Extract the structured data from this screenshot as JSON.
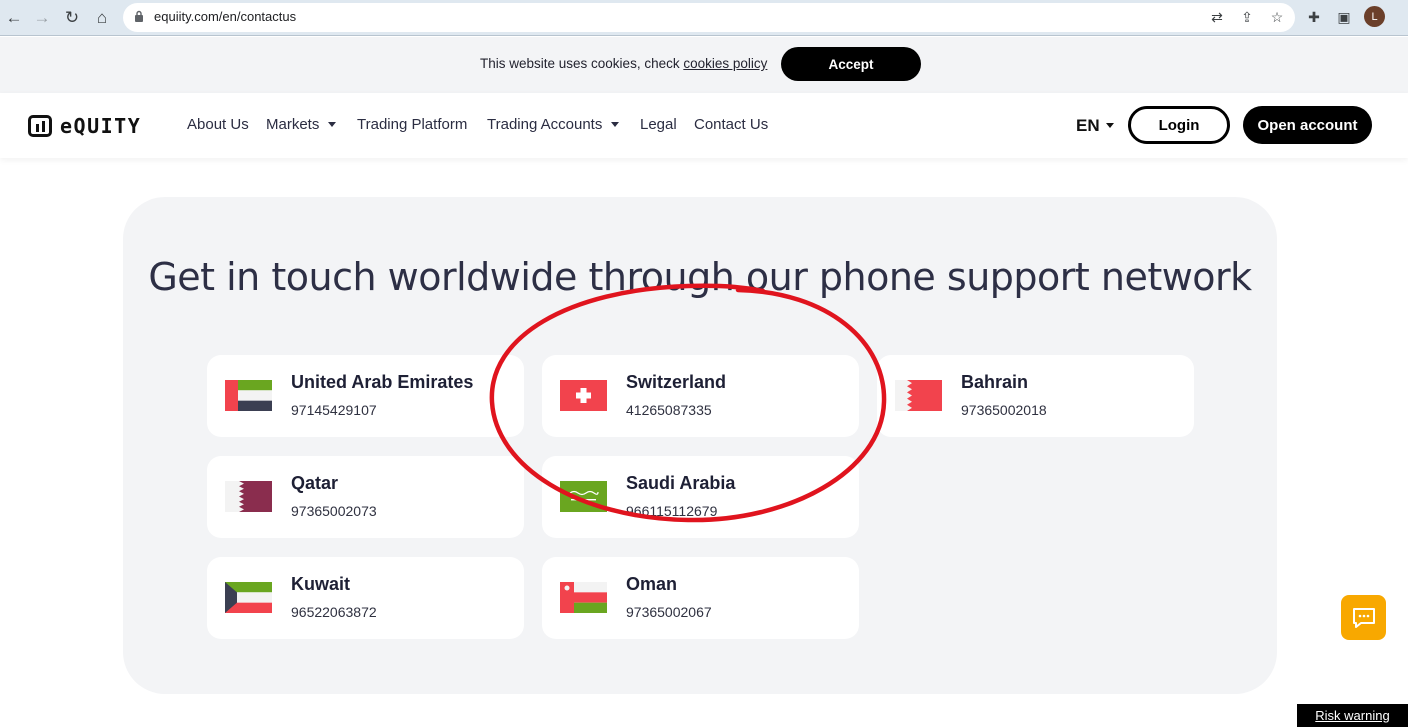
{
  "browser": {
    "url": "equiity.com/en/contactus",
    "profile_initial": "L"
  },
  "cookie": {
    "text": "This website uses cookies, check ",
    "link": "cookies policy",
    "accept": "Accept"
  },
  "header": {
    "logo_text": "eQUITY",
    "menu": [
      "About Us",
      "Markets",
      "Trading Platform",
      "Trading Accounts",
      "Legal",
      "Contact Us"
    ],
    "lang": "EN",
    "login": "Login",
    "open_account": "Open account"
  },
  "main": {
    "heading": "Get in touch worldwide through our phone support network",
    "contacts": [
      {
        "country": "United Arab Emirates",
        "phone": "97145429107"
      },
      {
        "country": "Switzerland",
        "phone": "41265087335"
      },
      {
        "country": "Bahrain",
        "phone": "97365002018"
      },
      {
        "country": "Qatar",
        "phone": "97365002073"
      },
      {
        "country": "Saudi Arabia",
        "phone": "966115112679"
      },
      {
        "country": "Kuwait",
        "phone": "96522063872"
      },
      {
        "country": "Oman",
        "phone": "97365002067"
      }
    ]
  },
  "footer": {
    "risk_warning": "Risk warning"
  },
  "colors": {
    "accent": "#000000",
    "annotation": "#e0141e",
    "chat": "#f8a800"
  }
}
